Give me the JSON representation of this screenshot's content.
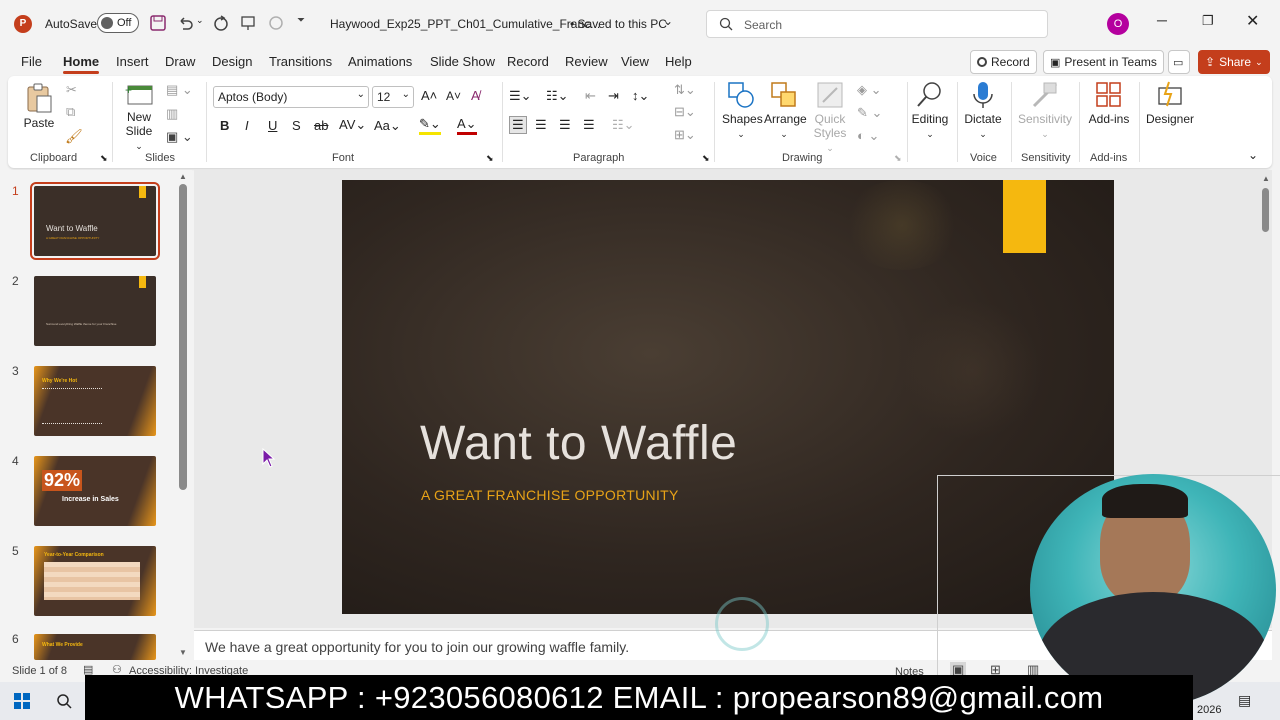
{
  "titlebar": {
    "autosave_label": "AutoSave",
    "autosave_state": "Off",
    "doc_title": "Haywood_Exp25_PPT_Ch01_Cumulative_Franc...",
    "save_status": "• Saved to this PC",
    "search_placeholder": "Search",
    "user_initial": "O"
  },
  "menu": {
    "items": [
      "File",
      "Home",
      "Insert",
      "Draw",
      "Design",
      "Transitions",
      "Animations",
      "Slide Show",
      "Record",
      "Review",
      "View",
      "Help"
    ],
    "record_btn": "Record",
    "present_btn": "Present in Teams",
    "share_btn": "Share"
  },
  "ribbon": {
    "clipboard": {
      "paste": "Paste",
      "label": "Clipboard"
    },
    "slides": {
      "new_slide_1": "New",
      "new_slide_2": "Slide",
      "label": "Slides"
    },
    "font": {
      "name": "Aptos (Body)",
      "size": "12",
      "label": "Font"
    },
    "paragraph": {
      "label": "Paragraph"
    },
    "drawing": {
      "shapes": "Shapes",
      "arrange": "Arrange",
      "quick_styles_1": "Quick",
      "quick_styles_2": "Styles",
      "label": "Drawing"
    },
    "editing": {
      "editing": "Editing"
    },
    "voice": {
      "dictate": "Dictate",
      "label": "Voice"
    },
    "sensitivity": {
      "btn": "Sensitivity",
      "label": "Sensitivity"
    },
    "addins": {
      "btn": "Add-ins",
      "label": "Add-ins"
    },
    "designer": {
      "btn": "Designer"
    }
  },
  "thumbnails": [
    {
      "num": "1",
      "title": "Want to Waffle",
      "subtitle": "A GREAT FRANCHISE OPPORTUNITY"
    },
    {
      "num": "2",
      "title": "Surround everything Waffle theme for your Franchise",
      "subtitle": ""
    },
    {
      "num": "3",
      "title": "Why We're Hot",
      "subtitle": ""
    },
    {
      "num": "4",
      "title": "92%",
      "subtitle": "Increase in Sales"
    },
    {
      "num": "5",
      "title": "Year-to-Year Comparison",
      "subtitle": ""
    },
    {
      "num": "6",
      "title": "What We Provide",
      "subtitle": ""
    }
  ],
  "slide": {
    "title": "Want to Waffle",
    "subtitle": "A GREAT FRANCHISE OPPORTUNITY"
  },
  "notes": {
    "text": "We have a great opportunity for you to join our growing waffle family."
  },
  "status": {
    "slide_count": "Slide 1 of 8",
    "accessibility": "Accessibility: Investigate",
    "notes_btn": "Notes"
  },
  "taskbar": {
    "year_fragment": "2026"
  },
  "banner": {
    "text": "WHATSAPP : +923056080612 EMAIL : propearson89@gmail.com"
  },
  "colors": {
    "accent": "#c43e1c",
    "slide_accent": "#f5b80f",
    "subtitle": "#e8a317"
  }
}
